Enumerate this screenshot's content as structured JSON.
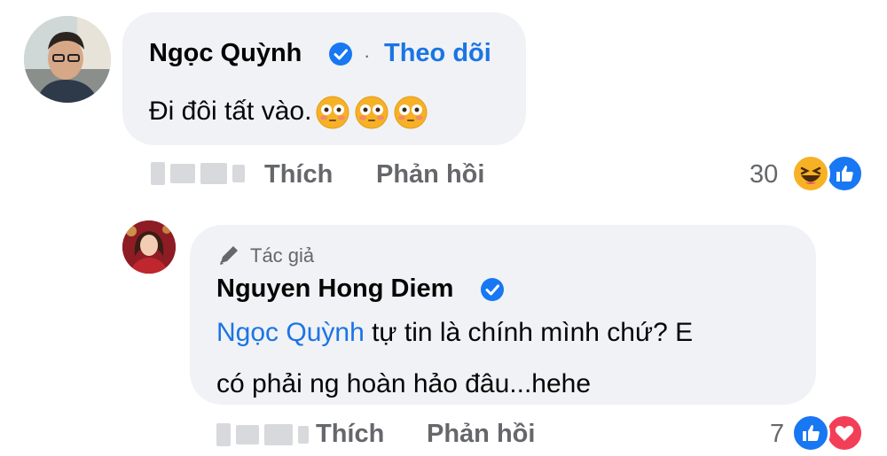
{
  "comment": {
    "author": "Ngọc Quỳnh",
    "follow_label": "Theo dõi",
    "separator": "·",
    "text": "Đi đôi tất vào.",
    "emojis": [
      "flushed-face-icon",
      "flushed-face-icon",
      "flushed-face-icon"
    ],
    "like_label": "Thích",
    "reply_label": "Phản hồi",
    "reaction_count": "30",
    "reactions": [
      "haha-reaction-icon",
      "like-reaction-icon"
    ]
  },
  "reply": {
    "author_tag": "Tác giả",
    "author": "Nguyen Hong Diem",
    "mention": "Ngọc Quỳnh",
    "text_line1": " tự tin là chính mình chứ? E",
    "text_line2": "có phải ng hoàn hảo đâu...hehe",
    "like_label": "Thích",
    "reply_label": "Phản hồi",
    "reaction_count": "7",
    "reactions": [
      "like-reaction-icon",
      "love-reaction-icon"
    ]
  },
  "colors": {
    "bubble": "#f0f2f5",
    "link_blue": "#1b74e4",
    "meta_gray": "#65676b",
    "like_blue": "#1877f2",
    "love_red": "#f33e58",
    "haha_yellow": "#f7b125"
  }
}
